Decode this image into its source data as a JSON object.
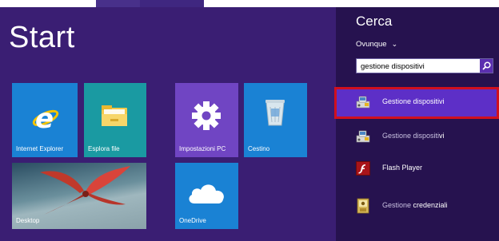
{
  "start": {
    "title": "Start",
    "tiles": {
      "ie": {
        "label": "Internet Explorer"
      },
      "explorer": {
        "label": "Esplora file"
      },
      "settings": {
        "label": "Impostazioni PC"
      },
      "recycle_bin": {
        "label": "Cestino"
      },
      "desktop": {
        "label": "Desktop"
      },
      "onedrive": {
        "label": "OneDrive"
      }
    }
  },
  "search": {
    "title": "Cerca",
    "scope": "Ovunque",
    "query": "gestione dispositivi",
    "results": [
      {
        "pre": "",
        "highlight": "Gestione dispositivi",
        "post": "",
        "icon": "device-manager-icon",
        "selected": true
      },
      {
        "pre": "Gestione dispositi",
        "highlight": "vi",
        "post": "",
        "icon": "device-manager-icon"
      },
      {
        "pre": "",
        "highlight": "Flash Player",
        "post": "",
        "icon": "flash-player-icon"
      },
      {
        "pre": "Gestione ",
        "highlight": "credenziali",
        "post": "",
        "icon": "credential-manager-icon"
      }
    ]
  },
  "colors": {
    "start_background": "#3a1e73",
    "search_pane": "#26124f",
    "selected_result": "#5d2fc7",
    "highlight_border": "#d0101e"
  }
}
